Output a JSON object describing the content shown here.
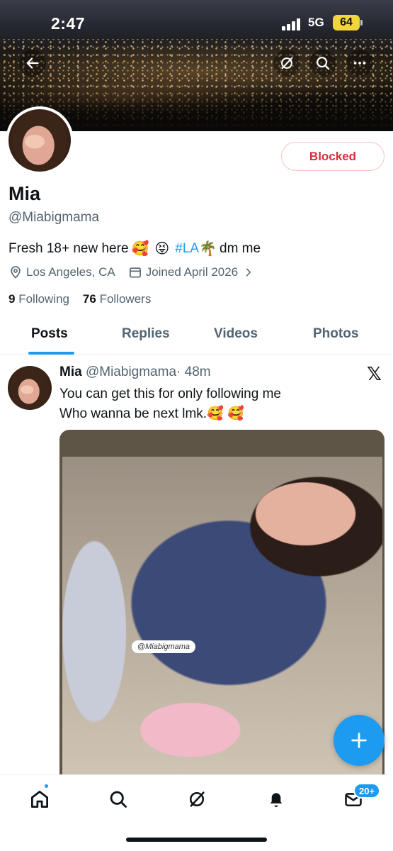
{
  "status_bar": {
    "time": "2:47",
    "network": "5G",
    "battery": "64"
  },
  "top_nav": {
    "back_icon": "arrow-left-icon",
    "grok_icon": "grok-icon",
    "search_icon": "search-icon",
    "more_icon": "more-horizontal-icon"
  },
  "profile": {
    "name": "Mia",
    "handle": "@Miabigmama",
    "blocked_label": "Blocked",
    "bio_text": "Fresh 18+ new here",
    "bio_emoji_1": "🥰",
    "bio_emoji_2": "😝",
    "bio_hashtag": "#LA",
    "bio_emoji_3": "🌴",
    "bio_end": "dm me",
    "location": "Los Angeles, CA",
    "joined": "Joined April 2026",
    "following_count": "9",
    "following_label": "Following",
    "followers_count": "76",
    "followers_label": "Followers"
  },
  "tabs": [
    {
      "label": "Posts",
      "active": true
    },
    {
      "label": "Replies",
      "active": false
    },
    {
      "label": "Videos",
      "active": false
    },
    {
      "label": "Photos",
      "active": false
    }
  ],
  "tweet": {
    "name": "Mia",
    "handle": "@Miabigmama",
    "time": "· 48m",
    "line1": "You can get this for only following me",
    "line2": "Who wanna be next lmk.🥰 🥰",
    "media_watermark": "@Miabigmama"
  },
  "bottom_nav": {
    "messages_badge": "20+"
  },
  "colors": {
    "accent": "#1d9bf0",
    "blocked_red": "#d92d3b",
    "secondary_text": "#536471"
  }
}
